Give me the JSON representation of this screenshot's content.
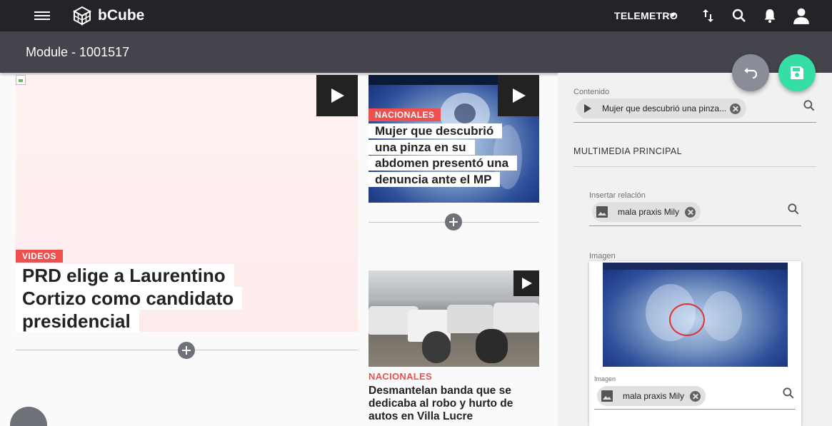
{
  "topbar": {
    "brand": "bCube",
    "site_selector": "TELEMETRO",
    "icons": [
      "menu-icon",
      "bcube-logo-icon",
      "sort-icon",
      "search-icon",
      "bell-icon",
      "user-icon"
    ]
  },
  "module": {
    "title": "Module - 1001517"
  },
  "main_story": {
    "tag": "VIDEOS",
    "headline": "PRD elige a Laurentino Cortizo como candidato presidencial"
  },
  "story_two": {
    "tag": "NACIONALES",
    "headline": "Mujer que descubrió una pinza en su abdomen presentó una denuncia ante el MP"
  },
  "story_three": {
    "tag": "NACIONALES",
    "headline": "Desmantelan banda que se dedicaba al robo y hurto de autos en Villa Lucre"
  },
  "panel": {
    "contenido_label": "Contenido",
    "contenido_chip": "Mujer que descubrió una pinza...",
    "section_title": "MULTIMEDIA PRINCIPAL",
    "relacion_label": "Insertar relación",
    "relacion_chip": "mala praxis Mily",
    "imagen_label": "Imagen",
    "imagen_card_label": "Imagen",
    "imagen_chip": "mala praxis Mily"
  },
  "colors": {
    "topbar": "#232428",
    "module_bar": "#43444c",
    "accent_red": "#ee4f4f",
    "save_green": "#35dfa4",
    "undo_gray": "#8a8c98"
  }
}
